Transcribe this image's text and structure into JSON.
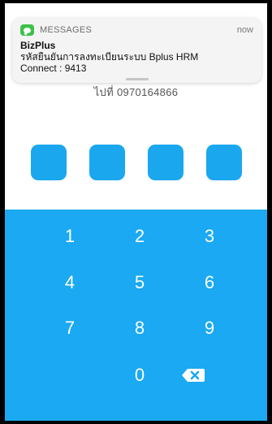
{
  "notification": {
    "app_name": "MESSAGES",
    "time": "now",
    "sender": "BizPlus",
    "message_line1": "รหัสยืนยันการลงทะเบียนระบบ Bplus HRM",
    "message_line2": "Connect : 9413",
    "icon": "messages-app-icon"
  },
  "sent_to": {
    "label": "ไปที่",
    "phone": "0970164866"
  },
  "pin": {
    "length": 4,
    "entered": 0
  },
  "keypad": {
    "keys": [
      "1",
      "2",
      "3",
      "4",
      "5",
      "6",
      "7",
      "8",
      "9",
      "0"
    ],
    "backspace_icon": "backspace-icon"
  },
  "colors": {
    "accent": "#1aa9f2",
    "pin_box": "#1aa7ee",
    "key_text": "#ffffff"
  }
}
